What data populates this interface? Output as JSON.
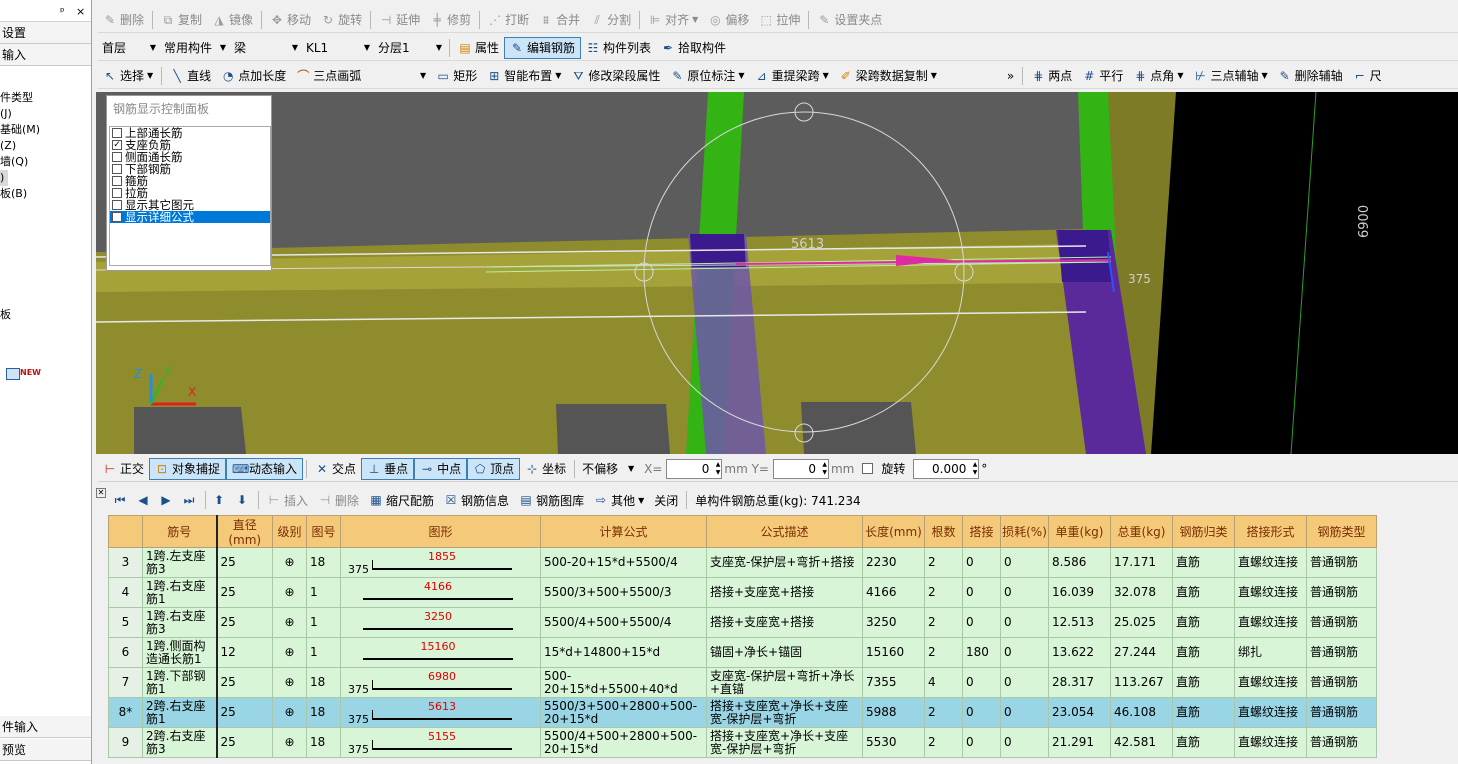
{
  "left_panel": {
    "header_pin": "ᵖ",
    "header_close": "×",
    "tabs_top": [
      "设置",
      "输入"
    ],
    "tree": [
      "件类型",
      "(J)",
      "基础(M)",
      "(Z)",
      "墙(Q)",
      ")",
      "板(B)",
      "",
      "",
      "",
      "",
      "",
      "",
      "",
      "板"
    ],
    "new_badge": "NEW",
    "tabs_bottom": [
      "件输入",
      "预览"
    ]
  },
  "toolbar1": {
    "items": [
      "删除",
      "复制",
      "镜像",
      "移动",
      "旋转",
      "延伸",
      "修剪",
      "打断",
      "合并",
      "分割",
      "对齐",
      "偏移",
      "拉伸",
      "设置夹点"
    ]
  },
  "toolbar2": {
    "floor": "首层",
    "component_type": "常用构件",
    "member": "梁",
    "name": "KL1",
    "layer": "分层1",
    "buttons": [
      "属性",
      "编辑钢筋",
      "构件列表",
      "拾取构件"
    ]
  },
  "toolbar3": {
    "items": [
      "选择",
      "直线",
      "点加长度",
      "三点画弧",
      "矩形",
      "智能布置",
      "修改梁段属性",
      "原位标注",
      "重提梁跨",
      "梁跨数据复制"
    ],
    "more": "»",
    "right_items": [
      "两点",
      "平行",
      "点角",
      "三点辅轴",
      "删除辅轴",
      "尺"
    ]
  },
  "viewport": {
    "panel_title": "钢筋显示控制面板",
    "checks": [
      {
        "label": "上部通长筋",
        "checked": false
      },
      {
        "label": "支座负筋",
        "checked": true
      },
      {
        "label": "侧面通长筋",
        "checked": false
      },
      {
        "label": "下部钢筋",
        "checked": false
      },
      {
        "label": "箍筋",
        "checked": false
      },
      {
        "label": "拉筋",
        "checked": false
      },
      {
        "label": "显示其它图元",
        "checked": false
      },
      {
        "label": "显示详细公式",
        "checked": false
      }
    ],
    "dim_label": "5613",
    "dim_right": "375",
    "dim_vertical": "6900",
    "axis_z": "Z",
    "axis_y": "Y",
    "axis_x": "X"
  },
  "snapbar": {
    "items": [
      "正交",
      "对象捕捉",
      "动态输入",
      "交点",
      "垂点",
      "中点",
      "顶点",
      "坐标"
    ],
    "offset_mode": "不偏移",
    "x_label": "X=",
    "x_value": "0",
    "y_label": "mm Y=",
    "y_value": "0",
    "unit": "mm",
    "rotate_label": "旋转",
    "rotate_value": "0.000",
    "degree": "°"
  },
  "rebarbar": {
    "items": [
      "插入",
      "删除",
      "缩尺配筋",
      "钢筋信息",
      "钢筋图库",
      "其他",
      "关闭"
    ],
    "total_weight": "单构件钢筋总重(kg): 741.234"
  },
  "table": {
    "headers": [
      "",
      "筋号",
      "直径(mm)",
      "级别",
      "图号",
      "图形",
      "计算公式",
      "公式描述",
      "长度(mm)",
      "根数",
      "搭接",
      "损耗(%)",
      "单重(kg)",
      "总重(kg)",
      "钢筋归类",
      "搭接形式",
      "钢筋类型"
    ],
    "rows": [
      {
        "no": "3",
        "name": "1跨.左支座筋3",
        "dia": "25",
        "grade": "⊕",
        "fig": "18",
        "hook": "375",
        "len_label": "1855",
        "formula": "500-20+15*d+5500/4",
        "desc": "支座宽-保护层+弯折+搭接",
        "length": "2230",
        "count": "2",
        "lap": "0",
        "loss": "0",
        "unit_w": "8.586",
        "total_w": "17.171",
        "cat": "直筋",
        "lap_type": "直螺纹连接",
        "type": "普通钢筋",
        "highlight": false
      },
      {
        "no": "4",
        "name": "1跨.右支座筋1",
        "dia": "25",
        "grade": "⊕",
        "fig": "1",
        "hook": "",
        "len_label": "4166",
        "formula": "5500/3+500+5500/3",
        "desc": "搭接+支座宽+搭接",
        "length": "4166",
        "count": "2",
        "lap": "0",
        "loss": "0",
        "unit_w": "16.039",
        "total_w": "32.078",
        "cat": "直筋",
        "lap_type": "直螺纹连接",
        "type": "普通钢筋",
        "highlight": false
      },
      {
        "no": "5",
        "name": "1跨.右支座筋3",
        "dia": "25",
        "grade": "⊕",
        "fig": "1",
        "hook": "",
        "len_label": "3250",
        "formula": "5500/4+500+5500/4",
        "desc": "搭接+支座宽+搭接",
        "length": "3250",
        "count": "2",
        "lap": "0",
        "loss": "0",
        "unit_w": "12.513",
        "total_w": "25.025",
        "cat": "直筋",
        "lap_type": "直螺纹连接",
        "type": "普通钢筋",
        "highlight": false
      },
      {
        "no": "6",
        "name": "1跨.侧面构造通长筋1",
        "dia": "12",
        "grade": "⊕",
        "fig": "1",
        "hook": "",
        "len_label": "15160",
        "formula": "15*d+14800+15*d",
        "desc": "锚固+净长+锚固",
        "length": "15160",
        "count": "2",
        "lap": "180",
        "loss": "0",
        "unit_w": "13.622",
        "total_w": "27.244",
        "cat": "直筋",
        "lap_type": "绑扎",
        "type": "普通钢筋",
        "highlight": false
      },
      {
        "no": "7",
        "name": "1跨.下部钢筋1",
        "dia": "25",
        "grade": "⊕",
        "fig": "18",
        "hook": "375",
        "len_label": "6980",
        "formula": "500-20+15*d+5500+40*d",
        "desc": "支座宽-保护层+弯折+净长+直锚",
        "length": "7355",
        "count": "4",
        "lap": "0",
        "loss": "0",
        "unit_w": "28.317",
        "total_w": "113.267",
        "cat": "直筋",
        "lap_type": "直螺纹连接",
        "type": "普通钢筋",
        "highlight": false
      },
      {
        "no": "8*",
        "name": "2跨.右支座筋1",
        "dia": "25",
        "grade": "⊕",
        "fig": "18",
        "hook": "375",
        "len_label": "5613",
        "formula": "5500/3+500+2800+500-20+15*d",
        "desc": "搭接+支座宽+净长+支座宽-保护层+弯折",
        "length": "5988",
        "count": "2",
        "lap": "0",
        "loss": "0",
        "unit_w": "23.054",
        "total_w": "46.108",
        "cat": "直筋",
        "lap_type": "直螺纹连接",
        "type": "普通钢筋",
        "highlight": true
      },
      {
        "no": "9",
        "name": "2跨.右支座筋3",
        "dia": "25",
        "grade": "⊕",
        "fig": "18",
        "hook": "375",
        "len_label": "5155",
        "formula": "5500/4+500+2800+500-20+15*d",
        "desc": "搭接+支座宽+净长+支座宽-保护层+弯折",
        "length": "5530",
        "count": "2",
        "lap": "0",
        "loss": "0",
        "unit_w": "21.291",
        "total_w": "42.581",
        "cat": "直筋",
        "lap_type": "直螺纹连接",
        "type": "普通钢筋",
        "highlight": false
      }
    ]
  },
  "colors": {
    "header_bg": "#f5c97a",
    "row_bg": "#d8f5d8",
    "highlight_bg": "#99d5e4",
    "beam_yellow": "#8a8a2a",
    "column_green": "#33b314",
    "support_purple": "#4a2c8a"
  }
}
